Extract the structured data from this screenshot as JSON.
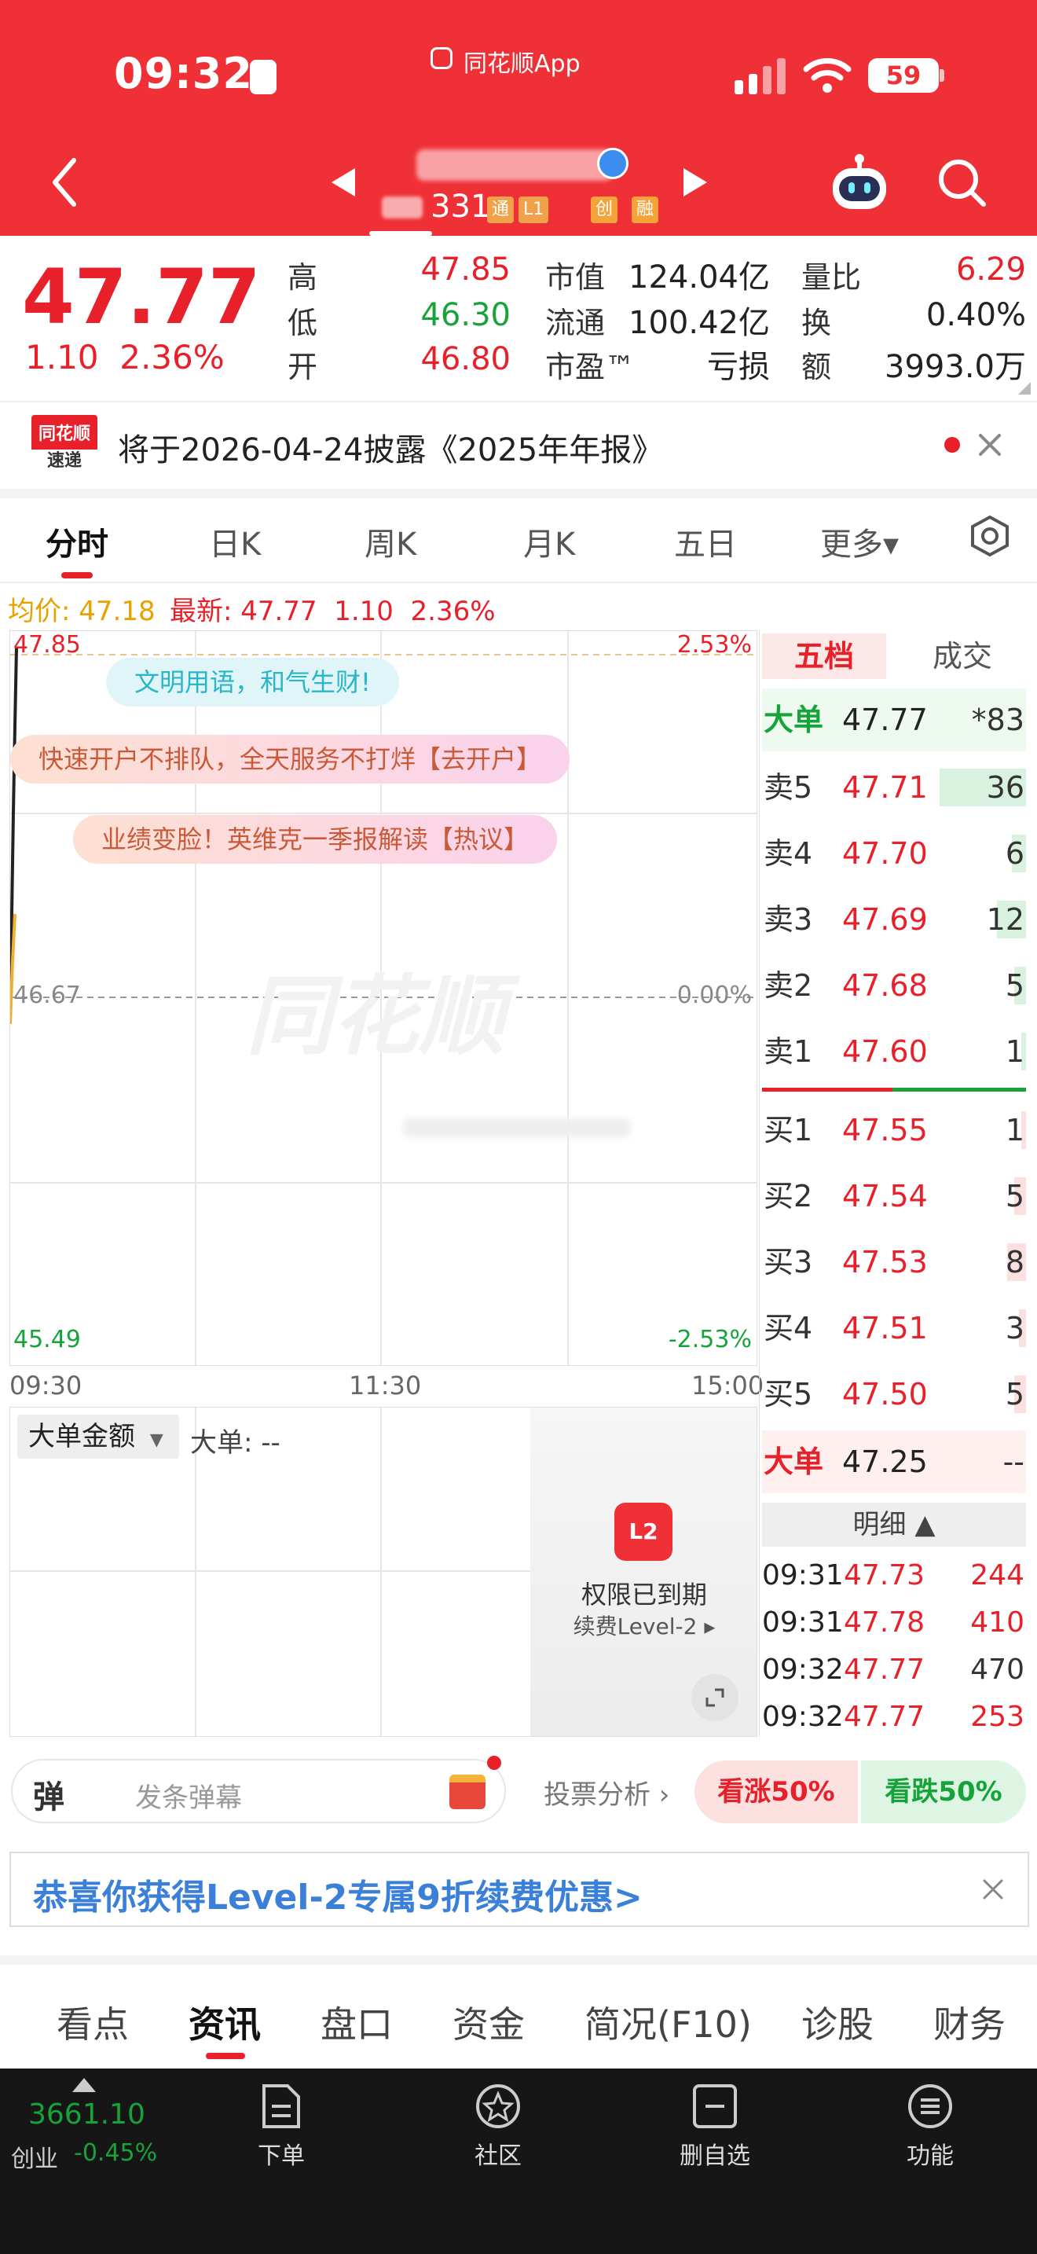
{
  "status": {
    "time": "09:32",
    "app": "同花顺App",
    "battery": "59"
  },
  "stock": {
    "code": "331",
    "tags": [
      "通",
      "L1",
      "创",
      "融"
    ]
  },
  "quote": {
    "price": "47.77",
    "change": "1.10",
    "change_pct": "2.36%",
    "high_label": "高",
    "high": "47.85",
    "low_label": "低",
    "low": "46.30",
    "open_label": "开",
    "open": "46.80",
    "mktcap_label": "市值",
    "mktcap": "124.04亿",
    "float_label": "流通",
    "float": "100.42亿",
    "pe_label": "市盈™",
    "pe": "亏损",
    "vr_label": "量比",
    "vr": "6.29",
    "turn_label": "换",
    "turn": "0.40%",
    "amt_label": "额",
    "amt": "3993.0万"
  },
  "notice": {
    "badge_top": "同花顺",
    "badge_bottom": "速递",
    "text": "将于2026-04-24披露《2025年年报》"
  },
  "chart_tabs": [
    "分时",
    "日K",
    "周K",
    "月K",
    "五日",
    "更多▾"
  ],
  "chart_header": {
    "avg": "均价: 47.18",
    "latest": "最新: 47.77  1.10  2.36%"
  },
  "chart": {
    "y_top": "47.85",
    "y_mid": "46.67",
    "y_bot": "45.49",
    "pct_top": "2.53%",
    "pct_mid": "0.00%",
    "pct_bot": "-2.53%",
    "x_labels": [
      "09:30",
      "11:30",
      "15:00"
    ],
    "watermark": "同花顺",
    "bubbles": [
      "文明用语，和气生财!",
      "快速开户不排队，全天服务不打烊【去开户】",
      "业绩变脸！英维克一季报解读【热议】"
    ]
  },
  "sub_chart": {
    "selector": "大单金额",
    "label": "大单: --",
    "lock_text": "权限已到期",
    "renew": "续费Level-2 ▸"
  },
  "order_book": {
    "tabs": [
      "五档",
      "成交"
    ],
    "big_top": {
      "label": "大单",
      "price": "47.77",
      "vol": "*83"
    },
    "sells": [
      {
        "label": "卖5",
        "price": "47.71",
        "vol": "36"
      },
      {
        "label": "卖4",
        "price": "47.70",
        "vol": "6"
      },
      {
        "label": "卖3",
        "price": "47.69",
        "vol": "12"
      },
      {
        "label": "卖2",
        "price": "47.68",
        "vol": "5"
      },
      {
        "label": "卖1",
        "price": "47.60",
        "vol": "1"
      }
    ],
    "buys": [
      {
        "label": "买1",
        "price": "47.55",
        "vol": "1"
      },
      {
        "label": "买2",
        "price": "47.54",
        "vol": "5"
      },
      {
        "label": "买3",
        "price": "47.53",
        "vol": "8"
      },
      {
        "label": "买4",
        "price": "47.51",
        "vol": "3"
      },
      {
        "label": "买5",
        "price": "47.50",
        "vol": "5"
      }
    ],
    "big_bottom": {
      "label": "大单",
      "price": "47.25",
      "vol": "--"
    },
    "detail_label": "明细 ▲",
    "ticks": [
      {
        "time": "09:31",
        "price": "47.73",
        "vol": "244",
        "vol_color": "#e8202a"
      },
      {
        "time": "09:31",
        "price": "47.78",
        "vol": "410",
        "vol_color": "#e8202a"
      },
      {
        "time": "09:32",
        "price": "47.77",
        "vol": "470",
        "vol_color": "#333333"
      },
      {
        "time": "09:32",
        "price": "47.77",
        "vol": "253",
        "vol_color": "#e8202a"
      }
    ]
  },
  "danmaku": {
    "badge": "弹",
    "placeholder": "发条弹幕",
    "vote": "投票分析 ›",
    "up": "看涨50%",
    "down": "看跌50%"
  },
  "promo": {
    "text": "恭喜你获得Level-2专属9折续费优惠>"
  },
  "section_tabs": [
    "看点",
    "资讯",
    "盘口",
    "资金",
    "简况(F10)",
    "诊股",
    "财务"
  ],
  "bottom_nav": {
    "index_value": "3661.10",
    "index_name": "创业",
    "index_change": "-0.45%",
    "items": [
      "下单",
      "社区",
      "删自选",
      "功能"
    ]
  },
  "colors": {
    "brand_red": "#ef3036",
    "up": "#e8202a",
    "down": "#16a33a"
  }
}
